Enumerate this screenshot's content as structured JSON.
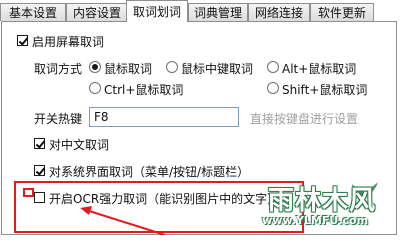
{
  "tabs": [
    {
      "label": "基本设置",
      "active": false
    },
    {
      "label": "内容设置",
      "active": false
    },
    {
      "label": "取词划词",
      "active": true
    },
    {
      "label": "词典管理",
      "active": false
    },
    {
      "label": "网络连接",
      "active": false
    },
    {
      "label": "软件更新",
      "active": false
    }
  ],
  "enable_screen_lookup": {
    "label": "启用屏幕取词",
    "checked": true
  },
  "lookup_method": {
    "label": "取词方式",
    "options": [
      {
        "label": "鼠标取词",
        "selected": true
      },
      {
        "label": "鼠标中键取词",
        "selected": false
      },
      {
        "label": "Alt+鼠标取词",
        "selected": false
      },
      {
        "label": "Ctrl+鼠标取词",
        "selected": false
      },
      {
        "label": "Shift+鼠标取词",
        "selected": false
      }
    ]
  },
  "hotkey": {
    "label": "开关热键",
    "value": "F8",
    "hint": "直接按键盘进行设置"
  },
  "chinese_lookup": {
    "label": "对中文取词",
    "checked": true
  },
  "system_ui_lookup": {
    "label": "对系统界面取词（菜单/按钮/标题栏）",
    "checked": true
  },
  "ocr_lookup": {
    "label": "开启OCR强力取词（能识别图片中的文字）",
    "checked": false
  },
  "watermark": {
    "title": "雨林木风",
    "url": "www.YLMFU.com"
  },
  "colors": {
    "highlight": "#e11c1c",
    "watermark": "#2f7d4e"
  }
}
